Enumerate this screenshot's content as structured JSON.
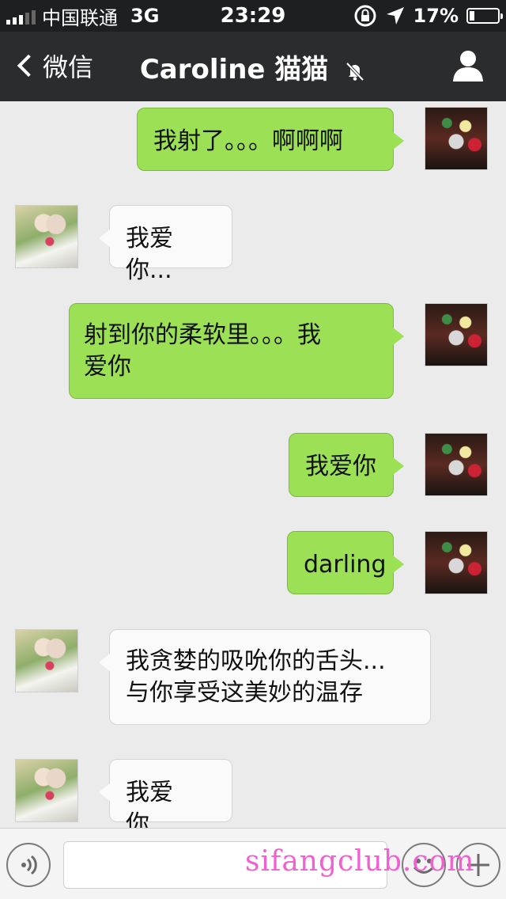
{
  "status_bar": {
    "carrier": "中国联通",
    "network": "3G",
    "time": "23:29",
    "battery": "17%",
    "battery_level": 0.17
  },
  "nav": {
    "back_label": "微信",
    "title": "Caroline 猫猫"
  },
  "messages": [
    {
      "from": "me",
      "text": "我射了。。。啊啊啊"
    },
    {
      "from": "her",
      "text": "我爱你..."
    },
    {
      "from": "me",
      "line1": "射到你的柔软里。。。我",
      "line2": "爱你"
    },
    {
      "from": "me",
      "text": "我爱你"
    },
    {
      "from": "me",
      "text": "darling"
    },
    {
      "from": "her",
      "line1": "我贪婪的吸吮你的舌头...",
      "line2": "与你享受这美妙的温存"
    },
    {
      "from": "her",
      "text": "我爱你..."
    }
  ],
  "input_bar": {
    "voice_icon": "voice-icon",
    "emoji_icon": "emoji-icon",
    "plus_icon": "plus-icon",
    "text_value": ""
  },
  "watermark": "sifangclub.com",
  "colors": {
    "my_bubble": "#9be055",
    "her_bubble": "#fafafa",
    "nav_bg": "#2b2c2e",
    "chat_bg": "#ebebeb",
    "watermark": "#f060d0"
  }
}
